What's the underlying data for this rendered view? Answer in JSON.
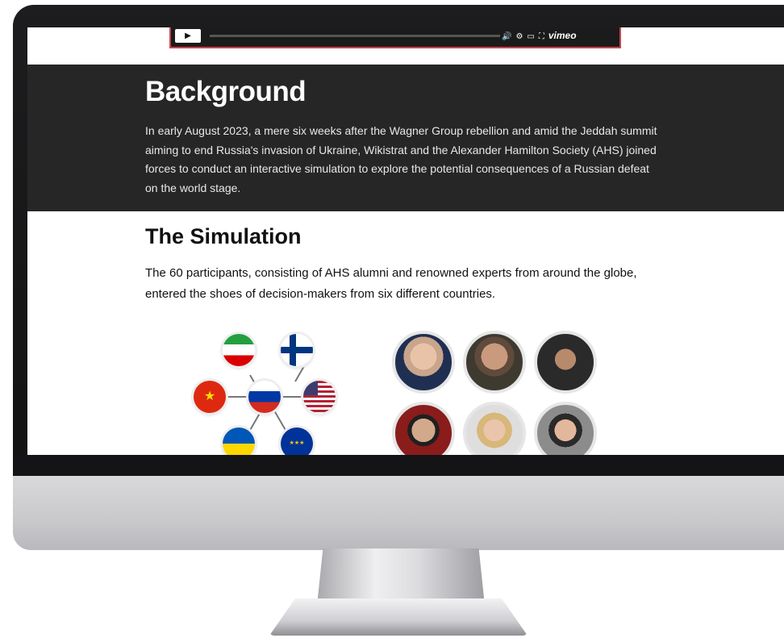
{
  "video": {
    "brand": "vimeo"
  },
  "background": {
    "title": "Background",
    "text": "In early August 2023, a mere six weeks after the Wagner Group rebellion and amid the Jeddah summit aiming to end Russia's invasion of Ukraine,  Wikistrat and the Alexander Hamilton Society (AHS) joined forces to conduct an interactive simulation to explore the potential consequences of a Russian defeat on the world stage."
  },
  "simulation": {
    "title": "The Simulation",
    "text": "The 60 participants, consisting of AHS alumni and renowned experts from around the globe, entered the shoes of decision-makers from six different countries."
  },
  "flags": [
    "iran-flag",
    "finland-flag",
    "china-flag",
    "russia-flag",
    "usa-flag",
    "ukraine-flag",
    "eu-flag"
  ],
  "colors": {
    "accent_border": "#c9434f",
    "dark_section": "#262626"
  }
}
